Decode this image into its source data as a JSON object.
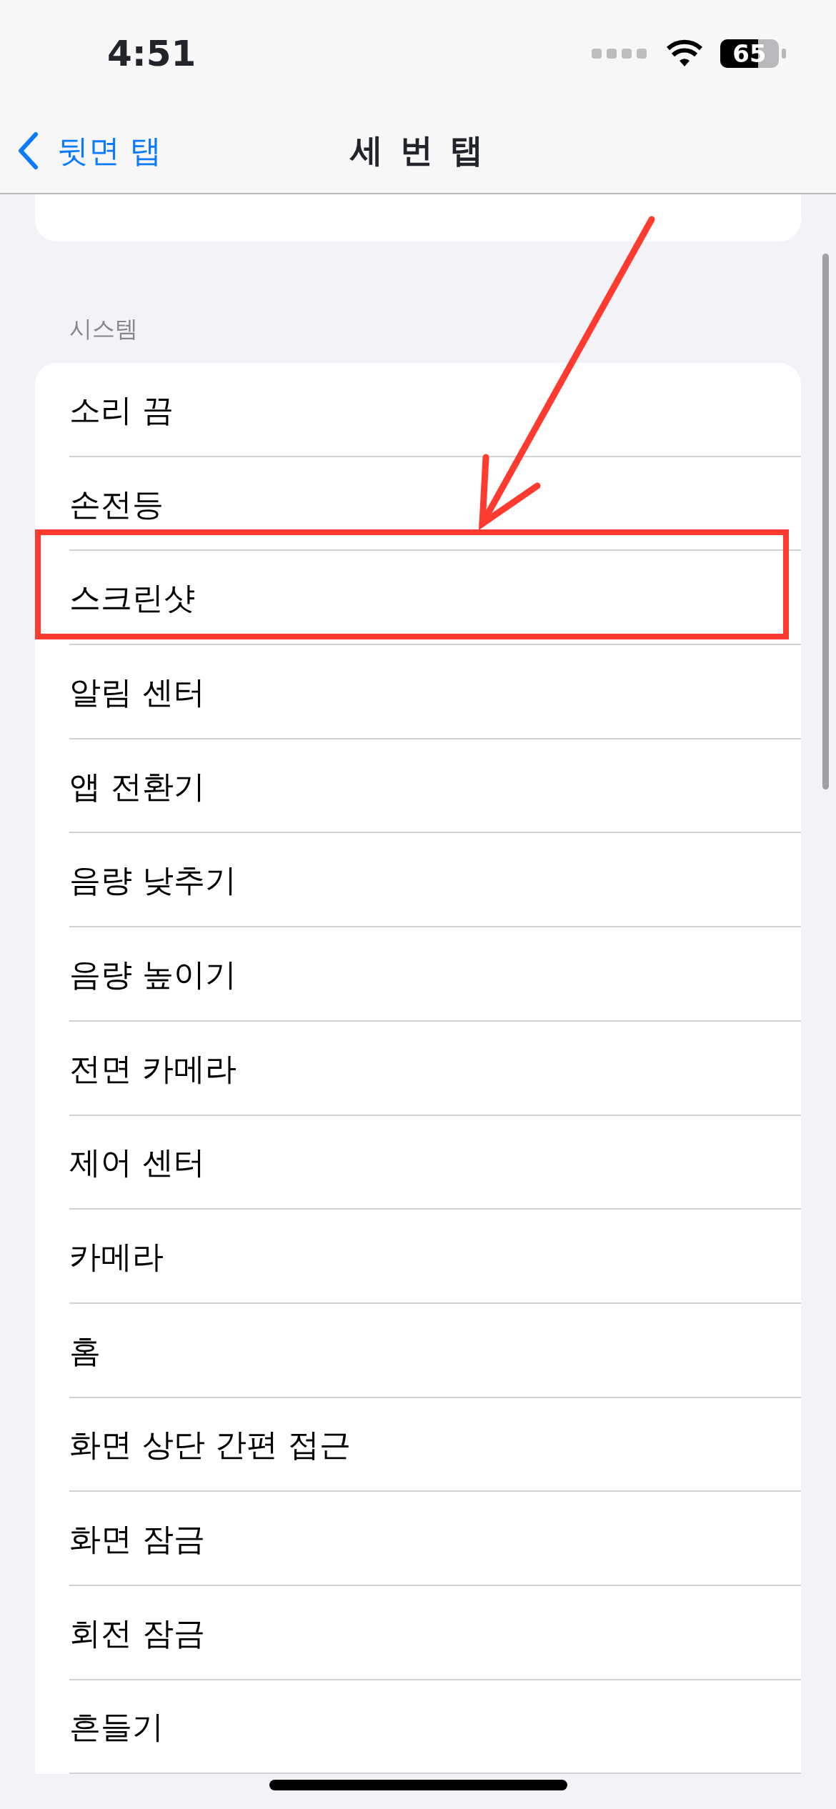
{
  "status_bar": {
    "time": "4:51",
    "battery": "65"
  },
  "nav": {
    "back_label": "뒷면 탭",
    "title": "세 번 탭"
  },
  "section": {
    "header": "시스템",
    "items": [
      {
        "label": "소리 끔",
        "highlighted": false
      },
      {
        "label": "손전등",
        "highlighted": false
      },
      {
        "label": "스크린샷",
        "highlighted": true
      },
      {
        "label": "알림 센터",
        "highlighted": false
      },
      {
        "label": "앱 전환기",
        "highlighted": false
      },
      {
        "label": "음량 낮추기",
        "highlighted": false
      },
      {
        "label": "음량 높이기",
        "highlighted": false
      },
      {
        "label": "전면 카메라",
        "highlighted": false
      },
      {
        "label": "제어 센터",
        "highlighted": false
      },
      {
        "label": "카메라",
        "highlighted": false
      },
      {
        "label": "홈",
        "highlighted": false
      },
      {
        "label": "화면 상단 간편 접근",
        "highlighted": false
      },
      {
        "label": "화면 잠금",
        "highlighted": false
      },
      {
        "label": "회전 잠금",
        "highlighted": false
      },
      {
        "label": "흔들기",
        "highlighted": false
      }
    ]
  }
}
